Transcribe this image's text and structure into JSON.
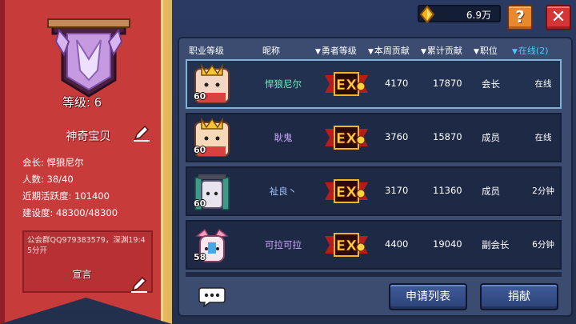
{
  "guild": {
    "level_text": "等级: 6",
    "name": "神奇宝贝",
    "info": [
      "会长: 悍狼尼尔",
      "人数: 38/40",
      "近期活跃度: 101400",
      "建设度: 48300/48300"
    ],
    "declaration_title": "宣言",
    "declaration": "公会群QQ979383579，深渊19:45分开"
  },
  "top_bar": {
    "currency_value": "6.9万",
    "help_label": "?",
    "close_label": "✕"
  },
  "table": {
    "headers": {
      "rank": "职业等级",
      "nickname": "昵称",
      "hero_level": "勇者等级",
      "weekly": "本周贡献",
      "total": "累计贡献",
      "position": "职位",
      "online": "在线(2)"
    },
    "rows": [
      {
        "level": "60",
        "nickname": "悍狼尼尔",
        "weekly": "4170",
        "total": "17870",
        "position": "会长",
        "online": "在线"
      },
      {
        "level": "60",
        "nickname": "耿鬼",
        "weekly": "3760",
        "total": "15870",
        "position": "成员",
        "online": "在线"
      },
      {
        "level": "60",
        "nickname": "祉良丶",
        "weekly": "3170",
        "total": "11360",
        "position": "成员",
        "online": "2分钟"
      },
      {
        "level": "58",
        "nickname": "可拉可拉",
        "weekly": "4400",
        "total": "19040",
        "position": "副会长",
        "online": "6分钟"
      }
    ]
  },
  "buttons": {
    "apply_list": "申请列表",
    "donate": "捐献"
  },
  "colors": {
    "banner": "#c73b3b",
    "banner_border": "#e2b65b",
    "online": "#49c9ff",
    "leader_name": "#6ef0b6",
    "member_name": "#cfa7ff"
  }
}
